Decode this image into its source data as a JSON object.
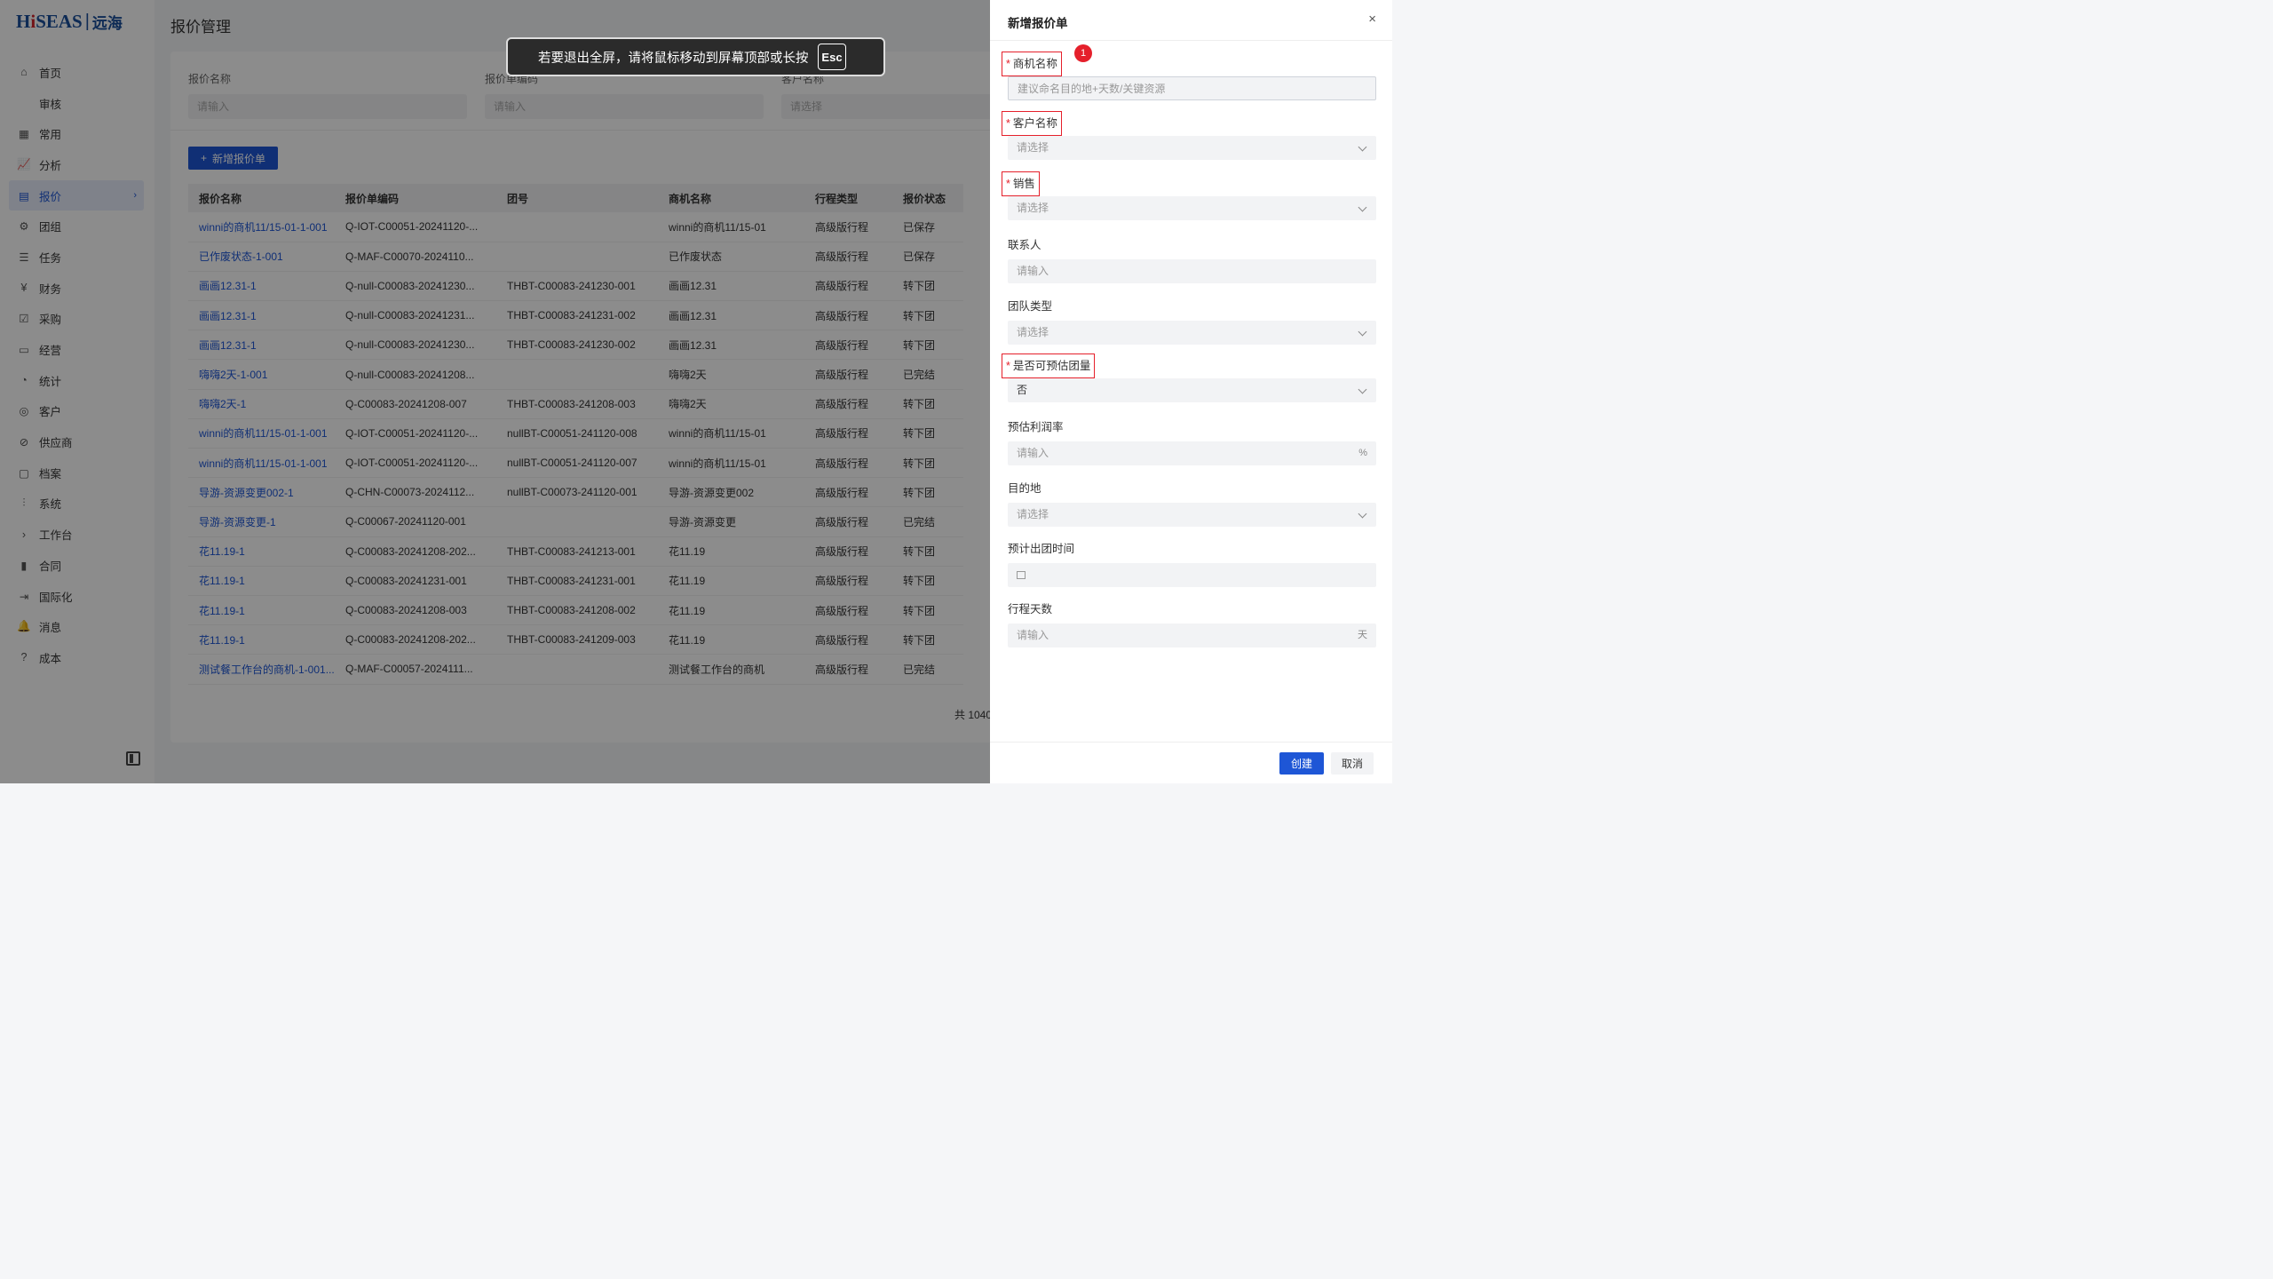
{
  "brand": {
    "logo_text_prefix": "H",
    "logo_text_i": "i",
    "logo_text_suffix": "SEAS",
    "logo_sep": "|",
    "logo_cn": "远海"
  },
  "sidebar": {
    "items": [
      {
        "label": "首页",
        "icon": "home-icon",
        "glyph": "⌂"
      },
      {
        "label": "审核",
        "icon": "",
        "glyph": ""
      },
      {
        "label": "常用",
        "icon": "grid-icon",
        "glyph": "▦"
      },
      {
        "label": "分析",
        "icon": "chart-icon",
        "glyph": "📈"
      },
      {
        "label": "报价",
        "icon": "document-icon",
        "glyph": "▤",
        "active": true
      },
      {
        "label": "团组",
        "icon": "gear-icon",
        "glyph": "⚙"
      },
      {
        "label": "任务",
        "icon": "task-icon",
        "glyph": "☰"
      },
      {
        "label": "财务",
        "icon": "yen-icon",
        "glyph": "¥"
      },
      {
        "label": "采购",
        "icon": "cart-icon",
        "glyph": "☑"
      },
      {
        "label": "经营",
        "icon": "monitor-icon",
        "glyph": "▭"
      },
      {
        "label": "统计",
        "icon": "pie-icon",
        "glyph": "◔"
      },
      {
        "label": "客户",
        "icon": "customer-icon",
        "glyph": "◎"
      },
      {
        "label": "供应商",
        "icon": "supplier-icon",
        "glyph": "⊘"
      },
      {
        "label": "档案",
        "icon": "archive-icon",
        "glyph": "▢"
      },
      {
        "label": "系统",
        "icon": "sliders-icon",
        "glyph": "⫶"
      },
      {
        "label": "工作台",
        "icon": "chevron-right-icon",
        "glyph": "›"
      },
      {
        "label": "合同",
        "icon": "contract-icon",
        "glyph": "▮"
      },
      {
        "label": "国际化",
        "icon": "logout-icon",
        "glyph": "⇥"
      },
      {
        "label": "消息",
        "icon": "bell-icon",
        "glyph": "🔔"
      },
      {
        "label": "成本",
        "icon": "question-icon",
        "glyph": "?"
      }
    ]
  },
  "main": {
    "title": "报价管理",
    "filters": [
      {
        "label": "报价名称",
        "placeholder": "请输入"
      },
      {
        "label": "报价单编码",
        "placeholder": "请输入"
      },
      {
        "label": "客户名称",
        "placeholder": "请选择"
      }
    ],
    "add_button": "新增报价单",
    "add_icon": "+",
    "table": {
      "columns": [
        "报价名称",
        "报价单编码",
        "团号",
        "商机名称",
        "行程类型",
        "报价状态"
      ],
      "rows": [
        [
          "winni的商机11/15-01-1-001",
          "Q-IOT-C00051-20241120-...",
          "",
          "winni的商机11/15-01",
          "高级版行程",
          "已保存"
        ],
        [
          "已作废状态-1-001",
          "Q-MAF-C00070-2024110...",
          "",
          "已作废状态",
          "高级版行程",
          "已保存"
        ],
        [
          "画画12.31-1",
          "Q-null-C00083-20241230...",
          "THBT-C00083-241230-001",
          "画画12.31",
          "高级版行程",
          "转下团"
        ],
        [
          "画画12.31-1",
          "Q-null-C00083-20241231...",
          "THBT-C00083-241231-002",
          "画画12.31",
          "高级版行程",
          "转下团"
        ],
        [
          "画画12.31-1",
          "Q-null-C00083-20241230...",
          "THBT-C00083-241230-002",
          "画画12.31",
          "高级版行程",
          "转下团"
        ],
        [
          "嗨嗨2天-1-001",
          "Q-null-C00083-20241208...",
          "",
          "嗨嗨2天",
          "高级版行程",
          "已完结"
        ],
        [
          "嗨嗨2天-1",
          "Q-C00083-20241208-007",
          "THBT-C00083-241208-003",
          "嗨嗨2天",
          "高级版行程",
          "转下团"
        ],
        [
          "winni的商机11/15-01-1-001",
          "Q-IOT-C00051-20241120-...",
          "nullBT-C00051-241120-008",
          "winni的商机11/15-01",
          "高级版行程",
          "转下团"
        ],
        [
          "winni的商机11/15-01-1-001",
          "Q-IOT-C00051-20241120-...",
          "nullBT-C00051-241120-007",
          "winni的商机11/15-01",
          "高级版行程",
          "转下团"
        ],
        [
          "导游-资源变更002-1",
          "Q-CHN-C00073-2024112...",
          "nullBT-C00073-241120-001",
          "导游-资源变更002",
          "高级版行程",
          "转下团"
        ],
        [
          "导游-资源变更-1",
          "Q-C00067-20241120-001",
          "",
          "导游-资源变更",
          "高级版行程",
          "已完结"
        ],
        [
          "花11.19-1",
          "Q-C00083-20241208-202...",
          "THBT-C00083-241213-001",
          "花11.19",
          "高级版行程",
          "转下团"
        ],
        [
          "花11.19-1",
          "Q-C00083-20241231-001",
          "THBT-C00083-241231-001",
          "花11.19",
          "高级版行程",
          "转下团"
        ],
        [
          "花11.19-1",
          "Q-C00083-20241208-003",
          "THBT-C00083-241208-002",
          "花11.19",
          "高级版行程",
          "转下团"
        ],
        [
          "花11.19-1",
          "Q-C00083-20241208-202...",
          "THBT-C00083-241209-003",
          "花11.19",
          "高级版行程",
          "转下团"
        ],
        [
          "测试餐工作台的商机-1-001...",
          "Q-MAF-C00057-2024111...",
          "",
          "测试餐工作台的商机",
          "高级版行程",
          "已完结"
        ]
      ]
    },
    "total": "共 1040"
  },
  "toast": {
    "message": "若要退出全屏，请将鼠标移动到屏幕顶部或长按",
    "key": "Esc"
  },
  "drawer": {
    "title": "新增报价单",
    "close": "×",
    "badge": "1",
    "fields": [
      {
        "label": "商机名称",
        "required": true,
        "boxed": true,
        "placeholder": "建议命名目的地+天数/关键资源",
        "type": "input"
      },
      {
        "label": "客户名称",
        "required": true,
        "boxed": true,
        "placeholder": "请选择",
        "type": "select"
      },
      {
        "label": "销售",
        "required": true,
        "boxed": true,
        "placeholder": "请选择",
        "type": "select"
      },
      {
        "label": "联系人",
        "required": false,
        "placeholder": "请输入",
        "type": "input"
      },
      {
        "label": "团队类型",
        "required": false,
        "placeholder": "请选择",
        "type": "select"
      },
      {
        "label": "是否可预估团量",
        "required": true,
        "boxed": true,
        "value": "否",
        "type": "select"
      },
      {
        "label": "预估利润率",
        "required": false,
        "placeholder": "请输入",
        "suffix": "%",
        "type": "input"
      },
      {
        "label": "目的地",
        "required": false,
        "placeholder": "请选择",
        "type": "select"
      },
      {
        "label": "预计出团时间",
        "required": false,
        "placeholder": "",
        "type": "date"
      },
      {
        "label": "行程天数",
        "required": false,
        "placeholder": "请输入",
        "suffix": "天",
        "type": "input"
      }
    ],
    "create_label": "创建",
    "cancel_label": "取消"
  }
}
